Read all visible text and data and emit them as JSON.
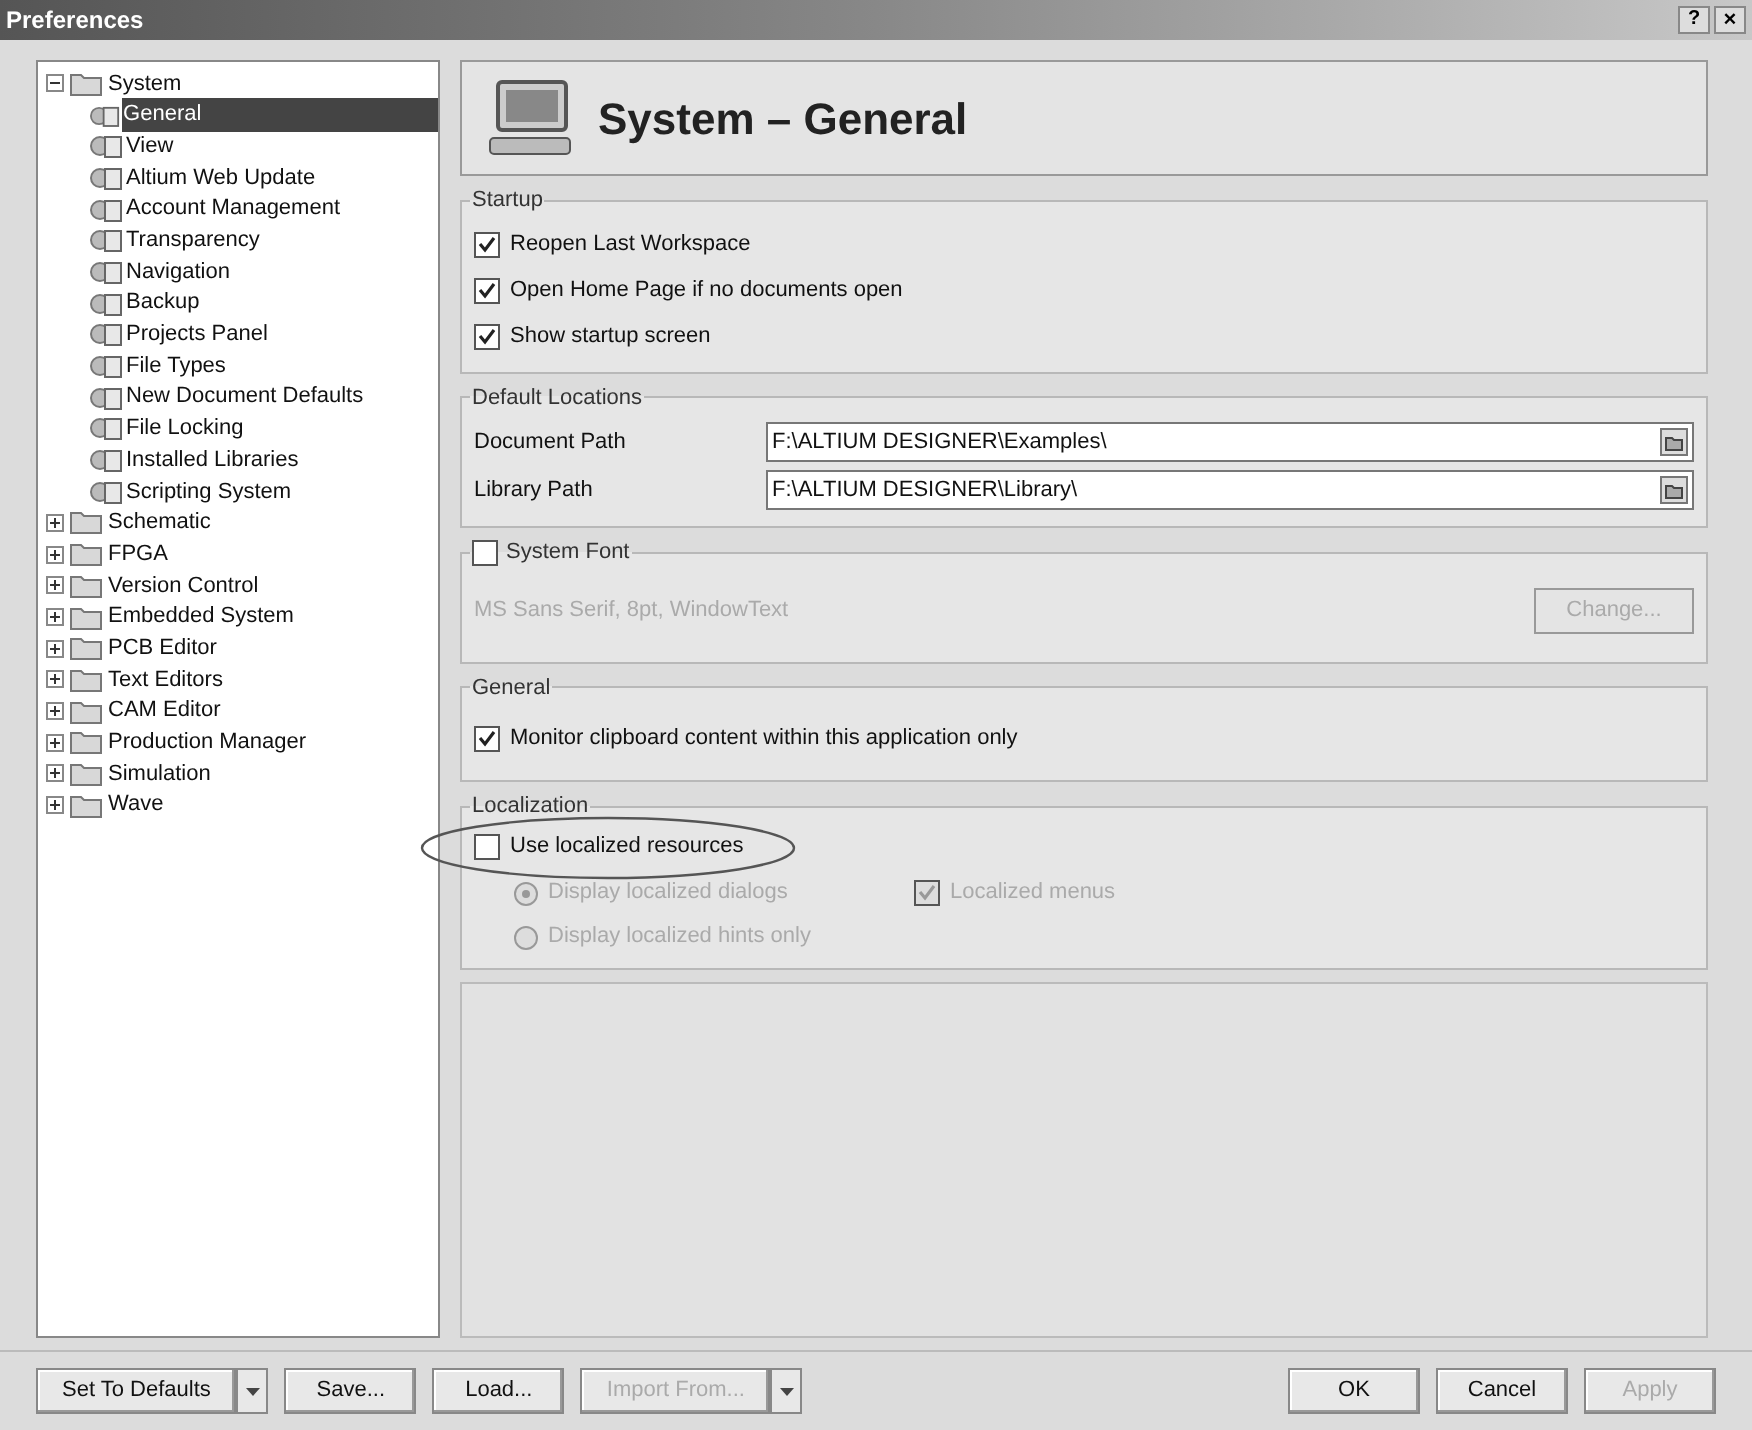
{
  "window": {
    "title": "Preferences",
    "help": "?",
    "close": "×"
  },
  "tree": [
    {
      "label": "System",
      "expanded": true,
      "children": [
        {
          "label": "General",
          "selected": true
        },
        {
          "label": "View",
          "selected": false
        },
        {
          "label": "Altium Web Update",
          "selected": false
        },
        {
          "label": "Account Management",
          "selected": false
        },
        {
          "label": "Transparency",
          "selected": false
        },
        {
          "label": "Navigation",
          "selected": false
        },
        {
          "label": "Backup",
          "selected": false
        },
        {
          "label": "Projects Panel",
          "selected": false
        },
        {
          "label": "File Types",
          "selected": false
        },
        {
          "label": "New Document Defaults",
          "selected": false
        },
        {
          "label": "File Locking",
          "selected": false
        },
        {
          "label": "Installed Libraries",
          "selected": false
        },
        {
          "label": "Scripting System",
          "selected": false
        }
      ]
    },
    {
      "label": "Schematic",
      "expanded": false
    },
    {
      "label": "FPGA",
      "expanded": false
    },
    {
      "label": "Version Control",
      "expanded": false
    },
    {
      "label": "Embedded System",
      "expanded": false
    },
    {
      "label": "PCB Editor",
      "expanded": false
    },
    {
      "label": "Text Editors",
      "expanded": false
    },
    {
      "label": "CAM Editor",
      "expanded": false
    },
    {
      "label": "Production Manager",
      "expanded": false
    },
    {
      "label": "Simulation",
      "expanded": false
    },
    {
      "label": "Wave",
      "expanded": false
    }
  ],
  "header": {
    "title": "System – General"
  },
  "startup": {
    "title": "Startup",
    "options": [
      {
        "label": "Reopen Last Workspace",
        "checked": true
      },
      {
        "label": "Open Home Page if no documents open",
        "checked": true
      },
      {
        "label": "Show startup screen",
        "checked": true
      }
    ]
  },
  "default_locations": {
    "title": "Default Locations",
    "paths": [
      {
        "label": "Document Path",
        "value": "F:\\ALTIUM DESIGNER\\Examples\\"
      },
      {
        "label": "Library Path",
        "value": "F:\\ALTIUM DESIGNER\\Library\\"
      }
    ]
  },
  "system_font": {
    "label": "System Font",
    "checked": false,
    "font": "MS Sans Serif, 8pt, WindowText",
    "button": "Change..."
  },
  "general": {
    "title": "General",
    "options": [
      {
        "label": "Monitor clipboard content within this application only",
        "checked": true
      }
    ]
  },
  "localization": {
    "title": "Localization",
    "use": {
      "label": "Use localized resources",
      "checked": false,
      "circled": true
    },
    "options": [
      {
        "kind": "radio",
        "label": "Display localized dialogs",
        "selected": true
      },
      {
        "kind": "checkbox",
        "label": "Localized menus",
        "checked": true
      },
      {
        "kind": "radio",
        "label": "Display localized hints only",
        "selected": false
      }
    ]
  },
  "left_buttons": [
    {
      "label": "Set To Defaults",
      "dropdown": true,
      "disabled": false
    },
    {
      "label": "Save...",
      "dropdown": false,
      "disabled": false
    },
    {
      "label": "Load...",
      "dropdown": false,
      "disabled": false
    },
    {
      "label": "Import From...",
      "dropdown": true,
      "disabled": true
    }
  ],
  "right_buttons": [
    {
      "label": "OK",
      "dropdown": false,
      "disabled": false
    },
    {
      "label": "Cancel",
      "dropdown": false,
      "disabled": false
    },
    {
      "label": "Apply",
      "dropdown": false,
      "disabled": true
    }
  ]
}
